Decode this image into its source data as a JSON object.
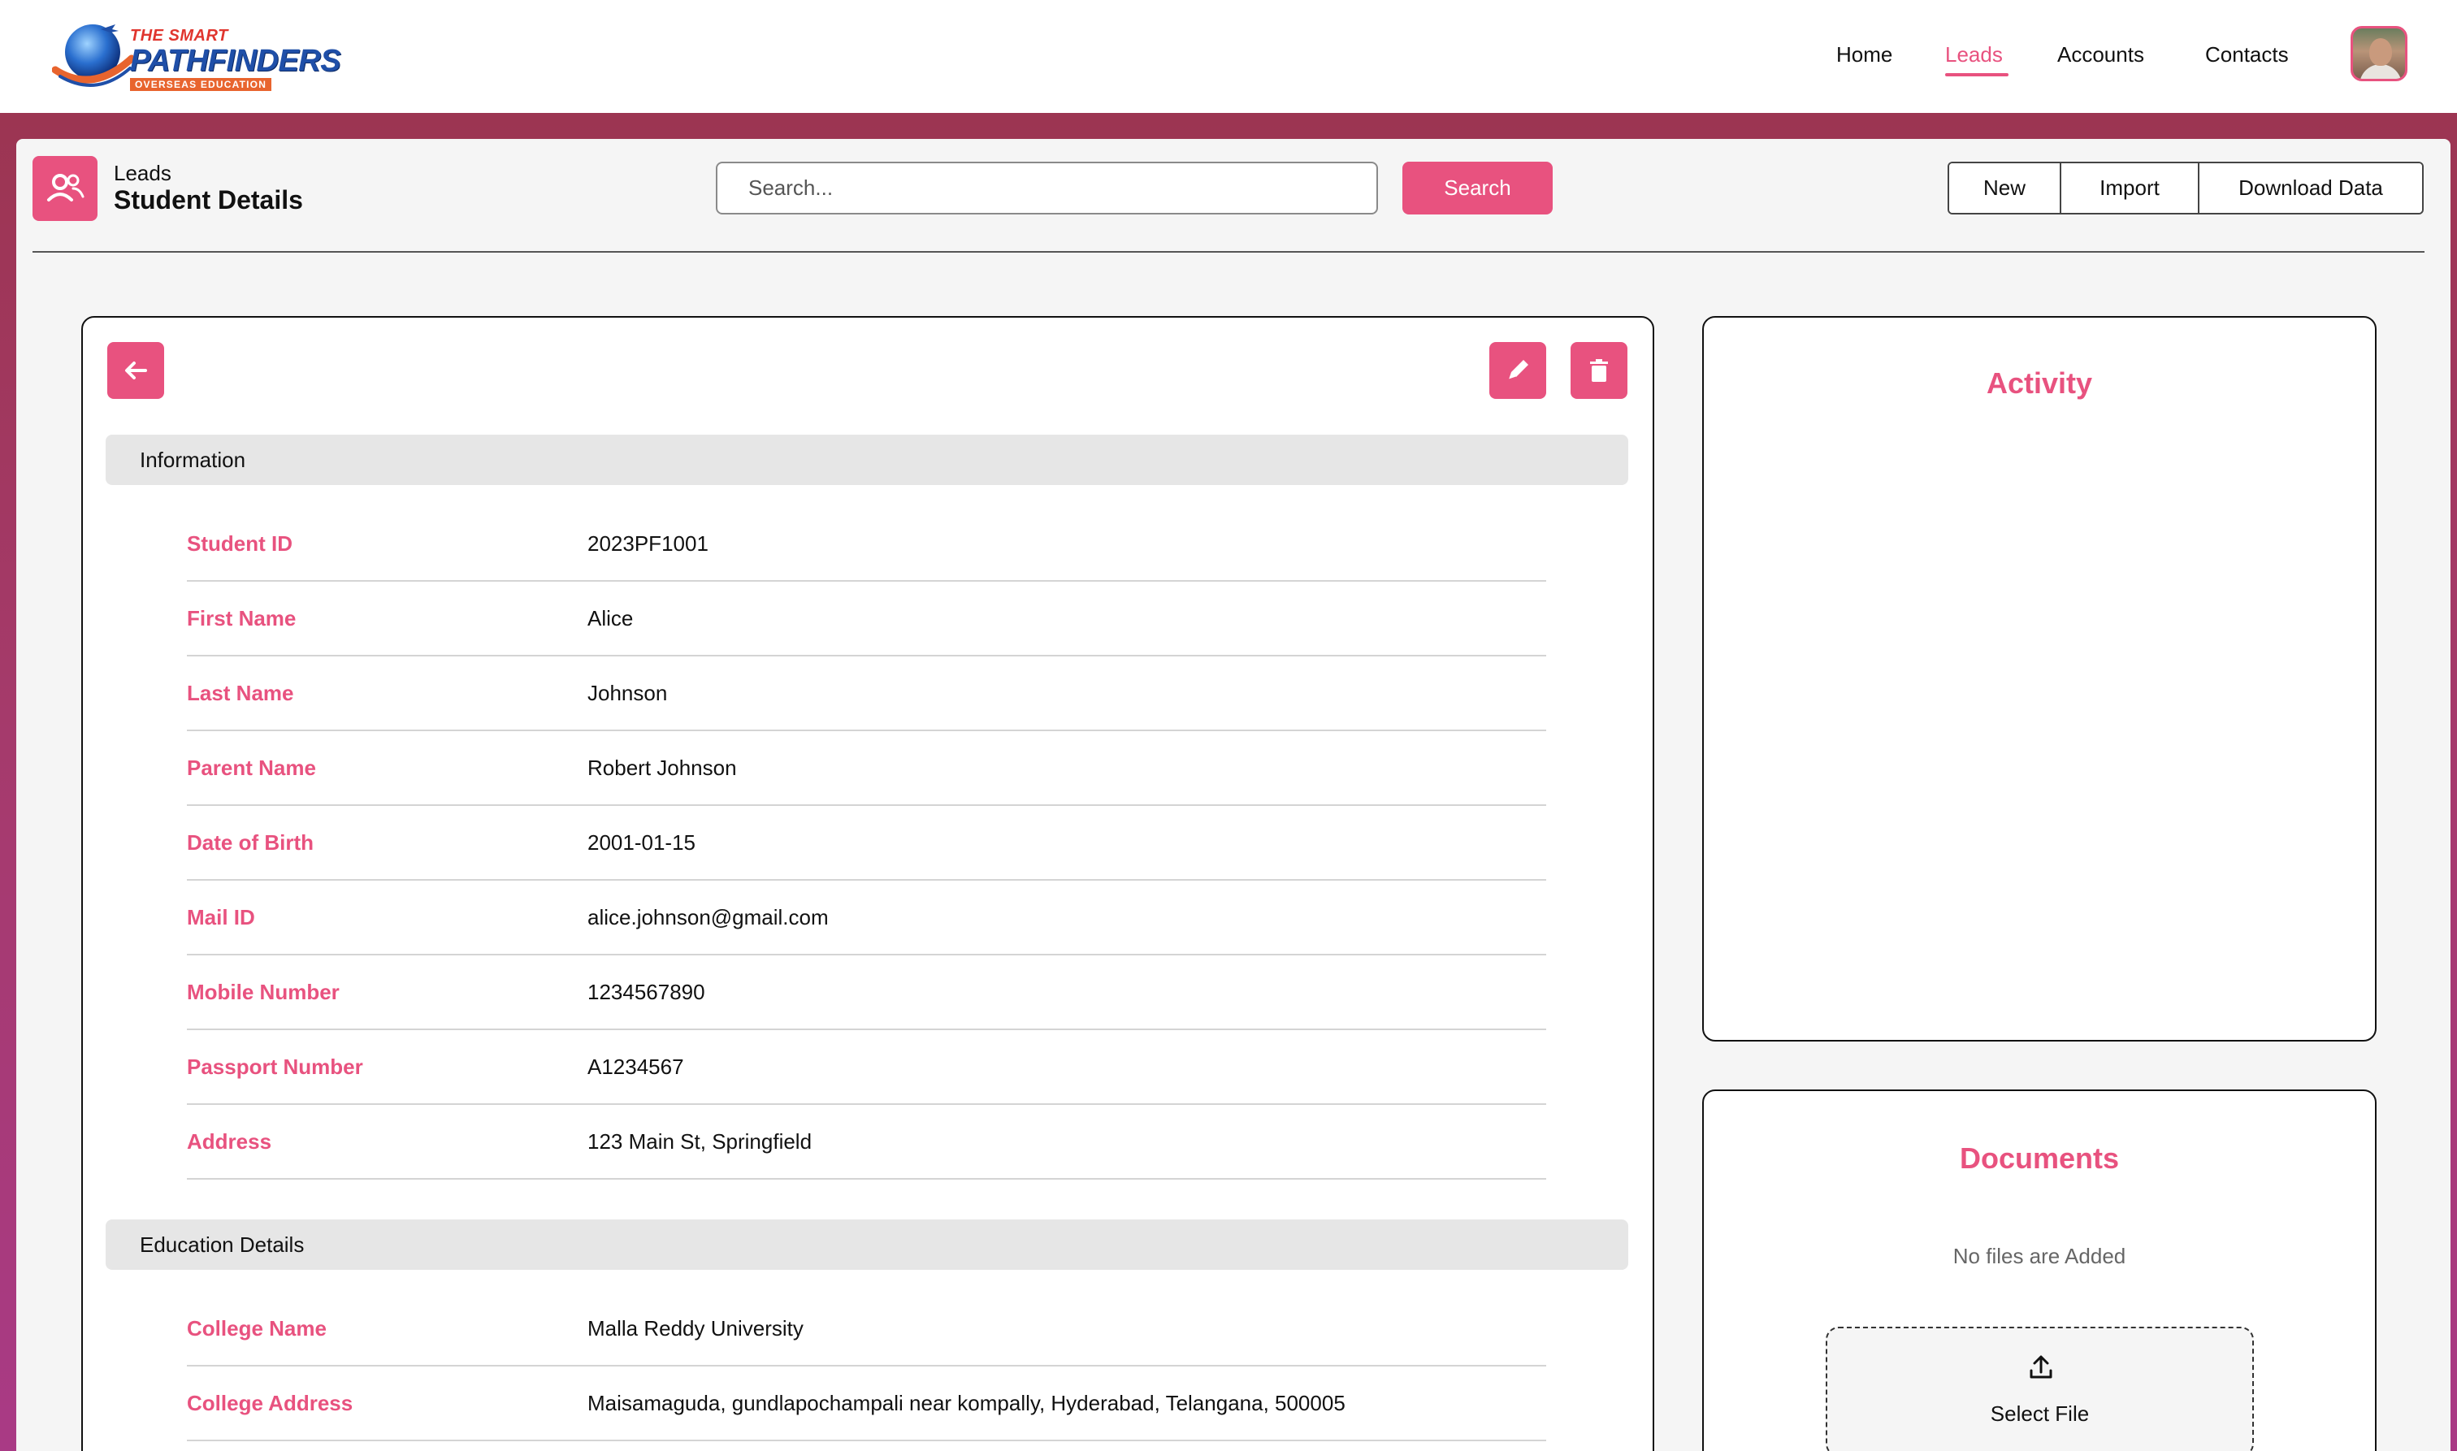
{
  "app": {
    "logo": {
      "line1": "THE SMART",
      "line2": "PATHFINDERS",
      "line3": "OVERSEAS EDUCATION"
    },
    "nav": [
      {
        "label": "Home"
      },
      {
        "label": "Leads"
      },
      {
        "label": "Accounts"
      },
      {
        "label": "Contacts"
      }
    ],
    "active_nav": "Leads",
    "accent_color": "#e8527f"
  },
  "header": {
    "breadcrumb": "Leads",
    "title": "Student Details",
    "icon": "user-group-icon",
    "search_placeholder": "Search...",
    "search_button": "Search",
    "actions": [
      "New",
      "Import",
      "Download Data"
    ]
  },
  "detail": {
    "back_icon": "arrow-left-icon",
    "edit_icon": "pencil-icon",
    "delete_icon": "trash-icon",
    "information": {
      "title": "Information",
      "fields": [
        {
          "label": "Student ID",
          "value": "2023PF1001"
        },
        {
          "label": "First Name",
          "value": "Alice"
        },
        {
          "label": "Last Name",
          "value": "Johnson"
        },
        {
          "label": "Parent Name",
          "value": "Robert Johnson"
        },
        {
          "label": "Date of Birth",
          "value": "2001-01-15"
        },
        {
          "label": "Mail ID",
          "value": "alice.johnson@gmail.com"
        },
        {
          "label": "Mobile Number",
          "value": "1234567890"
        },
        {
          "label": "Passport Number",
          "value": "A1234567"
        },
        {
          "label": "Address",
          "value": "123 Main St, Springfield"
        }
      ]
    },
    "education": {
      "title": "Education Details",
      "fields": [
        {
          "label": "College Name",
          "value": "Malla Reddy University"
        },
        {
          "label": "College Address",
          "value": "Maisamaguda, gundlapochampali near kompally, Hyderabad, Telangana, 500005"
        }
      ]
    }
  },
  "activity": {
    "title": "Activity"
  },
  "documents": {
    "title": "Documents",
    "empty_text": "No files are Added",
    "upload_label": "Select File",
    "upload_icon": "upload-icon"
  }
}
